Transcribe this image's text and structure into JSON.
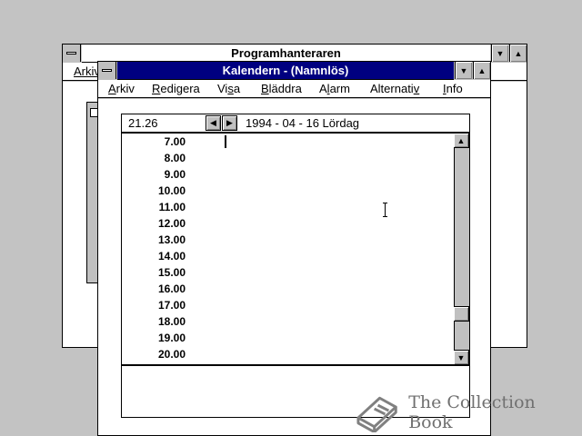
{
  "progman": {
    "title": "Programhanteraren",
    "menu_partial": "Arkiv"
  },
  "calendar": {
    "title": "Kalendern - (Namnlös)",
    "menu": [
      {
        "label": "Arkiv",
        "u": "A",
        "rest": "rkiv"
      },
      {
        "label": "Redigera",
        "u": "R",
        "rest": "edigera"
      },
      {
        "label": "Visa",
        "u": "",
        "pre": "Vi",
        "u2": "s",
        "post": "a"
      },
      {
        "label": "Bläddra",
        "u": "B",
        "rest": "läddra"
      },
      {
        "label": "Alarm",
        "pre": "A",
        "u2": "l",
        "post": "arm"
      },
      {
        "label": "Alternativ",
        "pre": "Alternati",
        "u2": "v",
        "post": ""
      },
      {
        "label": "Info",
        "u": "I",
        "rest": "nfo"
      }
    ],
    "current_time": "21.26",
    "date_line": "1994 - 04 - 16 Lördag",
    "time_slots": [
      "7.00",
      "8.00",
      "9.00",
      "10.00",
      "11.00",
      "12.00",
      "13.00",
      "14.00",
      "15.00",
      "16.00",
      "17.00",
      "18.00",
      "19.00",
      "20.00"
    ],
    "scrollbar_position": 0.85
  },
  "watermark": {
    "text": "The Collection Book",
    "icon": "book-icon"
  }
}
